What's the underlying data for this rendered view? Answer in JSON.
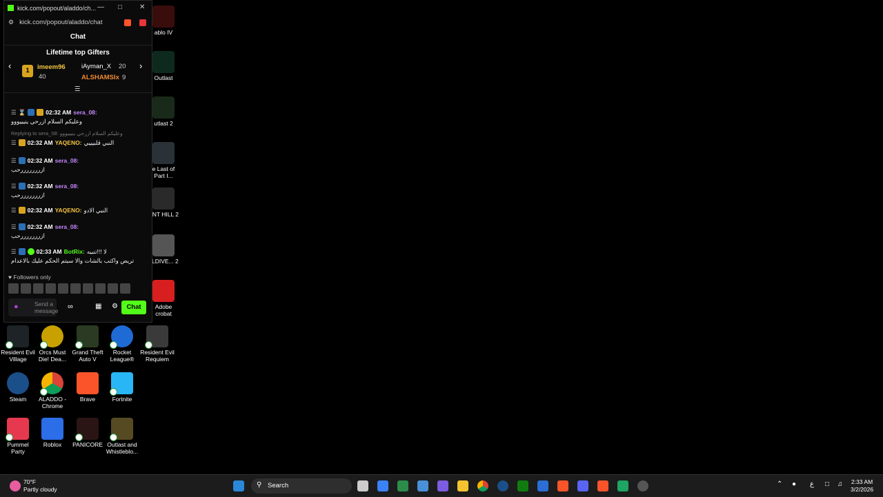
{
  "window": {
    "title": "kick.com/popout/aladdo/ch...",
    "address": "kick.com/popout/aladdo/chat"
  },
  "chat": {
    "header": "Chat",
    "gifters_title": "Lifetime top Gifters",
    "gifters": [
      {
        "rank": "1",
        "name": "imeem96",
        "count": "40"
      },
      {
        "name": "iAyman_X",
        "count": "20"
      },
      {
        "name": "ALSHAMSIx",
        "count": "9"
      }
    ],
    "messages": [
      {
        "time": "02:32 AM",
        "user": "sera_08:",
        "text": "وعليكم السلام ازرحي ينيييووو"
      },
      {
        "reply": "Replying to sera_08: وعليكم السلام ازرحي ينيييووو",
        "time": "02:32 AM",
        "user": "YAQENO:",
        "text": "النبي قلبيييي"
      },
      {
        "time": "02:32 AM",
        "user": "sera_08:",
        "text": "ازرررررررحب"
      },
      {
        "time": "02:32 AM",
        "user": "sera_08:",
        "text": "ازرررررررحب"
      },
      {
        "time": "02:32 AM",
        "user": "YAQENO:",
        "text": "النبي الادو"
      },
      {
        "time": "02:32 AM",
        "user": "sera_08:",
        "text": "ازرررررررحب"
      },
      {
        "time": "02:33 AM",
        "user": "BotRix:",
        "text": "لا !!!تنبيه",
        "text2": "تريص واكتب بالشات والا سيتم الحكم عليك بالاعدام"
      }
    ],
    "followers_only": "Followers only",
    "send_placeholder": "Send a message",
    "chat_button": "Chat"
  },
  "desktop_icons": [
    {
      "label": "ablo IV"
    },
    {
      "label": "Outlast"
    },
    {
      "label": "utlast 2"
    },
    {
      "label": "e Last of Part I..."
    },
    {
      "label": "ENT HILL 2"
    },
    {
      "label": "LLDIVE... 2"
    },
    {
      "label": "Adobe crobat"
    },
    {
      "label": "Resident Evil Village"
    },
    {
      "label": "Orcs Must Die! Dea..."
    },
    {
      "label": "Grand Theft Auto V"
    },
    {
      "label": "Rocket League®"
    },
    {
      "label": "Resident Evil Requiem"
    },
    {
      "label": "Steam"
    },
    {
      "label": "ALADDO - Chrome"
    },
    {
      "label": "Brave"
    },
    {
      "label": "Fortnite"
    },
    {
      "label": "Pummel Party"
    },
    {
      "label": "Roblox"
    },
    {
      "label": "PANICORE"
    },
    {
      "label": "Outlast and Whistleblo..."
    }
  ],
  "taskbar": {
    "weather_temp": "70°F",
    "weather_desc": "Partly cloudy",
    "search": "Search",
    "time": "2:33 AM",
    "date": "3/2/2026",
    "lang": "ع"
  }
}
